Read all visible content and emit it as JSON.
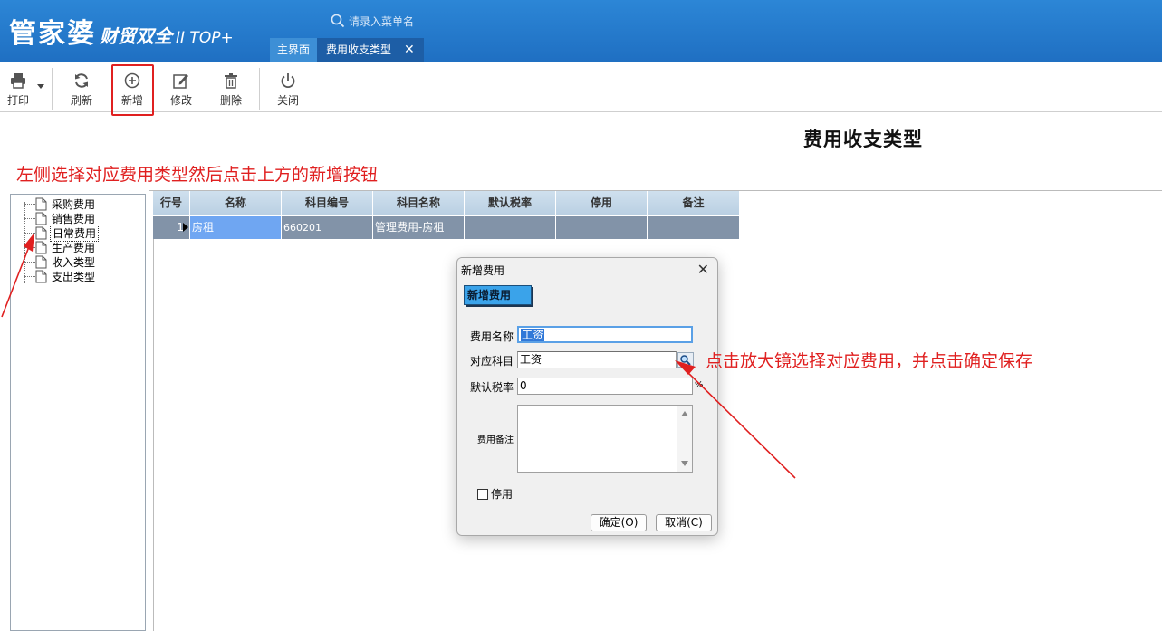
{
  "header": {
    "logo_main": "管家婆",
    "logo_sub": "财贸双全",
    "logo_ver": "II TOP+",
    "search_placeholder": "请录入菜单名",
    "tabs": [
      {
        "label": "主界面"
      },
      {
        "label": "费用收支类型",
        "close": "✕"
      }
    ]
  },
  "toolbar": {
    "print": "打印",
    "refresh": "刷新",
    "add": "新增",
    "edit": "修改",
    "delete": "删除",
    "close": "关闭"
  },
  "page_title": "费用收支类型",
  "annotations": {
    "left": "左侧选择对应费用类型然后点击上方的新增按钮",
    "right": "点击放大镜选择对应费用，并点击确定保存",
    "color": "#e02020"
  },
  "tree": {
    "items": [
      "采购费用",
      "销售费用",
      "日常费用",
      "生产费用",
      "收入类型",
      "支出类型"
    ],
    "selected": "日常费用"
  },
  "grid": {
    "headers": [
      "行号",
      "名称",
      "科目编号",
      "科目名称",
      "默认税率",
      "停用",
      "备注"
    ],
    "rows": [
      {
        "no": "1",
        "name": "房租",
        "code": "660201",
        "subject": "管理费用-房租",
        "tax": "",
        "disabled": "",
        "remark": ""
      }
    ]
  },
  "dialog": {
    "title": "新增费用",
    "close": "✕",
    "badge": "新增费用",
    "fields": {
      "name_label": "费用名称",
      "name_value": "工资",
      "subject_label": "对应科目",
      "subject_value": "工资",
      "tax_label": "默认税率",
      "tax_value": "0",
      "tax_unit": "%",
      "remark_label": "费用备注",
      "disabled_label": "停用"
    },
    "ok": "确定(O)",
    "cancel": "取消(C)"
  },
  "colors": {
    "header_bg": "#1f6fc2",
    "grid_row_bg": "#8293a8",
    "badge_bg": "#3aa3ea"
  }
}
